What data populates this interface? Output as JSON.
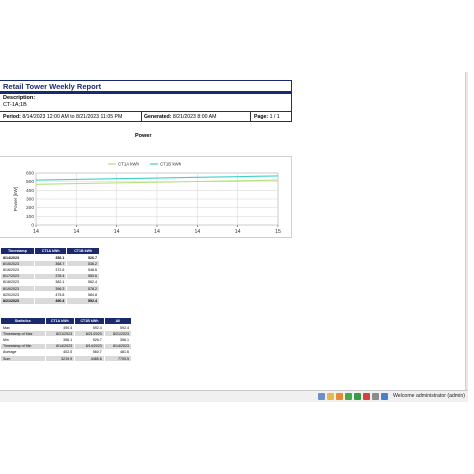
{
  "report": {
    "title": "Retail Tower Weekly Report",
    "description_label": "Description:",
    "description_value": "CT-1A;1B",
    "period_label": "Period:",
    "period_value": "8/14/2023 12:00 AM to 8/21/2023 11:05 PM",
    "generated_label": "Generated:",
    "generated_value": "8/21/2023 8:00 AM",
    "page_label": "Page:",
    "page_value": "1 / 1"
  },
  "chart_data": {
    "type": "line",
    "title": "Power",
    "ylabel": "Power [kW]",
    "xlabel": "",
    "x_ticks": [
      "14",
      "14",
      "14",
      "14",
      "14",
      "14",
      "15"
    ],
    "y_ticks": [
      0,
      100,
      200,
      300,
      400,
      500,
      600
    ],
    "ylim": [
      0,
      600
    ],
    "grid": true,
    "legend_position": "top",
    "series": [
      {
        "name": "CT1A kWh",
        "color": "#b6e07a",
        "values": [
          470,
          478,
          486,
          494,
          502,
          510,
          518
        ]
      },
      {
        "name": "CT1B kWh",
        "color": "#3fd0c8",
        "values": [
          518,
          526,
          534,
          542,
          550,
          558,
          566
        ]
      }
    ]
  },
  "timestamp_table": {
    "headers": [
      "Timestamp",
      "CT1A kWh",
      "CT1B kWh"
    ],
    "rows": [
      [
        "8/14/2023",
        "356.1",
        "526.7"
      ],
      [
        "8/15/2023",
        "368.7",
        "536.2"
      ],
      [
        "8/16/2023",
        "372.6",
        "548.6"
      ],
      [
        "8/17/2023",
        "378.4",
        "550.6"
      ],
      [
        "8/18/2023",
        "382.1",
        "562.4"
      ],
      [
        "8/19/2023",
        "396.3",
        "578.2"
      ],
      [
        "8/20/2023",
        "475.8",
        "584.8"
      ],
      [
        "8/21/2023",
        "490.4",
        "592.4"
      ]
    ],
    "bold_rows": [
      0,
      7
    ]
  },
  "stats_table": {
    "headers": [
      "Statistics",
      "CT1A kWh",
      "CT1B kWh",
      "All"
    ],
    "rows": [
      [
        "Max",
        "490.4",
        "592.4",
        "592.4"
      ],
      [
        "Timestamp of Max",
        "8/21/2023",
        "8/21/2023",
        "8/21/2023"
      ],
      [
        "Min",
        "356.1",
        "526.7",
        "356.1"
      ],
      [
        "Timestamp of Min",
        "8/14/2023",
        "8/14/2023",
        "8/14/2023"
      ],
      [
        "Average",
        "402.5",
        "560.7",
        "481.6"
      ],
      [
        "Sum",
        "3219.9",
        "4485.6",
        "7705.5"
      ]
    ]
  },
  "status_bar": {
    "welcome_text": "Welcome administrator (admin)",
    "icons": [
      "home-icon",
      "star-icon",
      "feed-icon",
      "add-icon",
      "refresh-icon",
      "stop-icon",
      "settings-icon",
      "help-icon"
    ]
  }
}
